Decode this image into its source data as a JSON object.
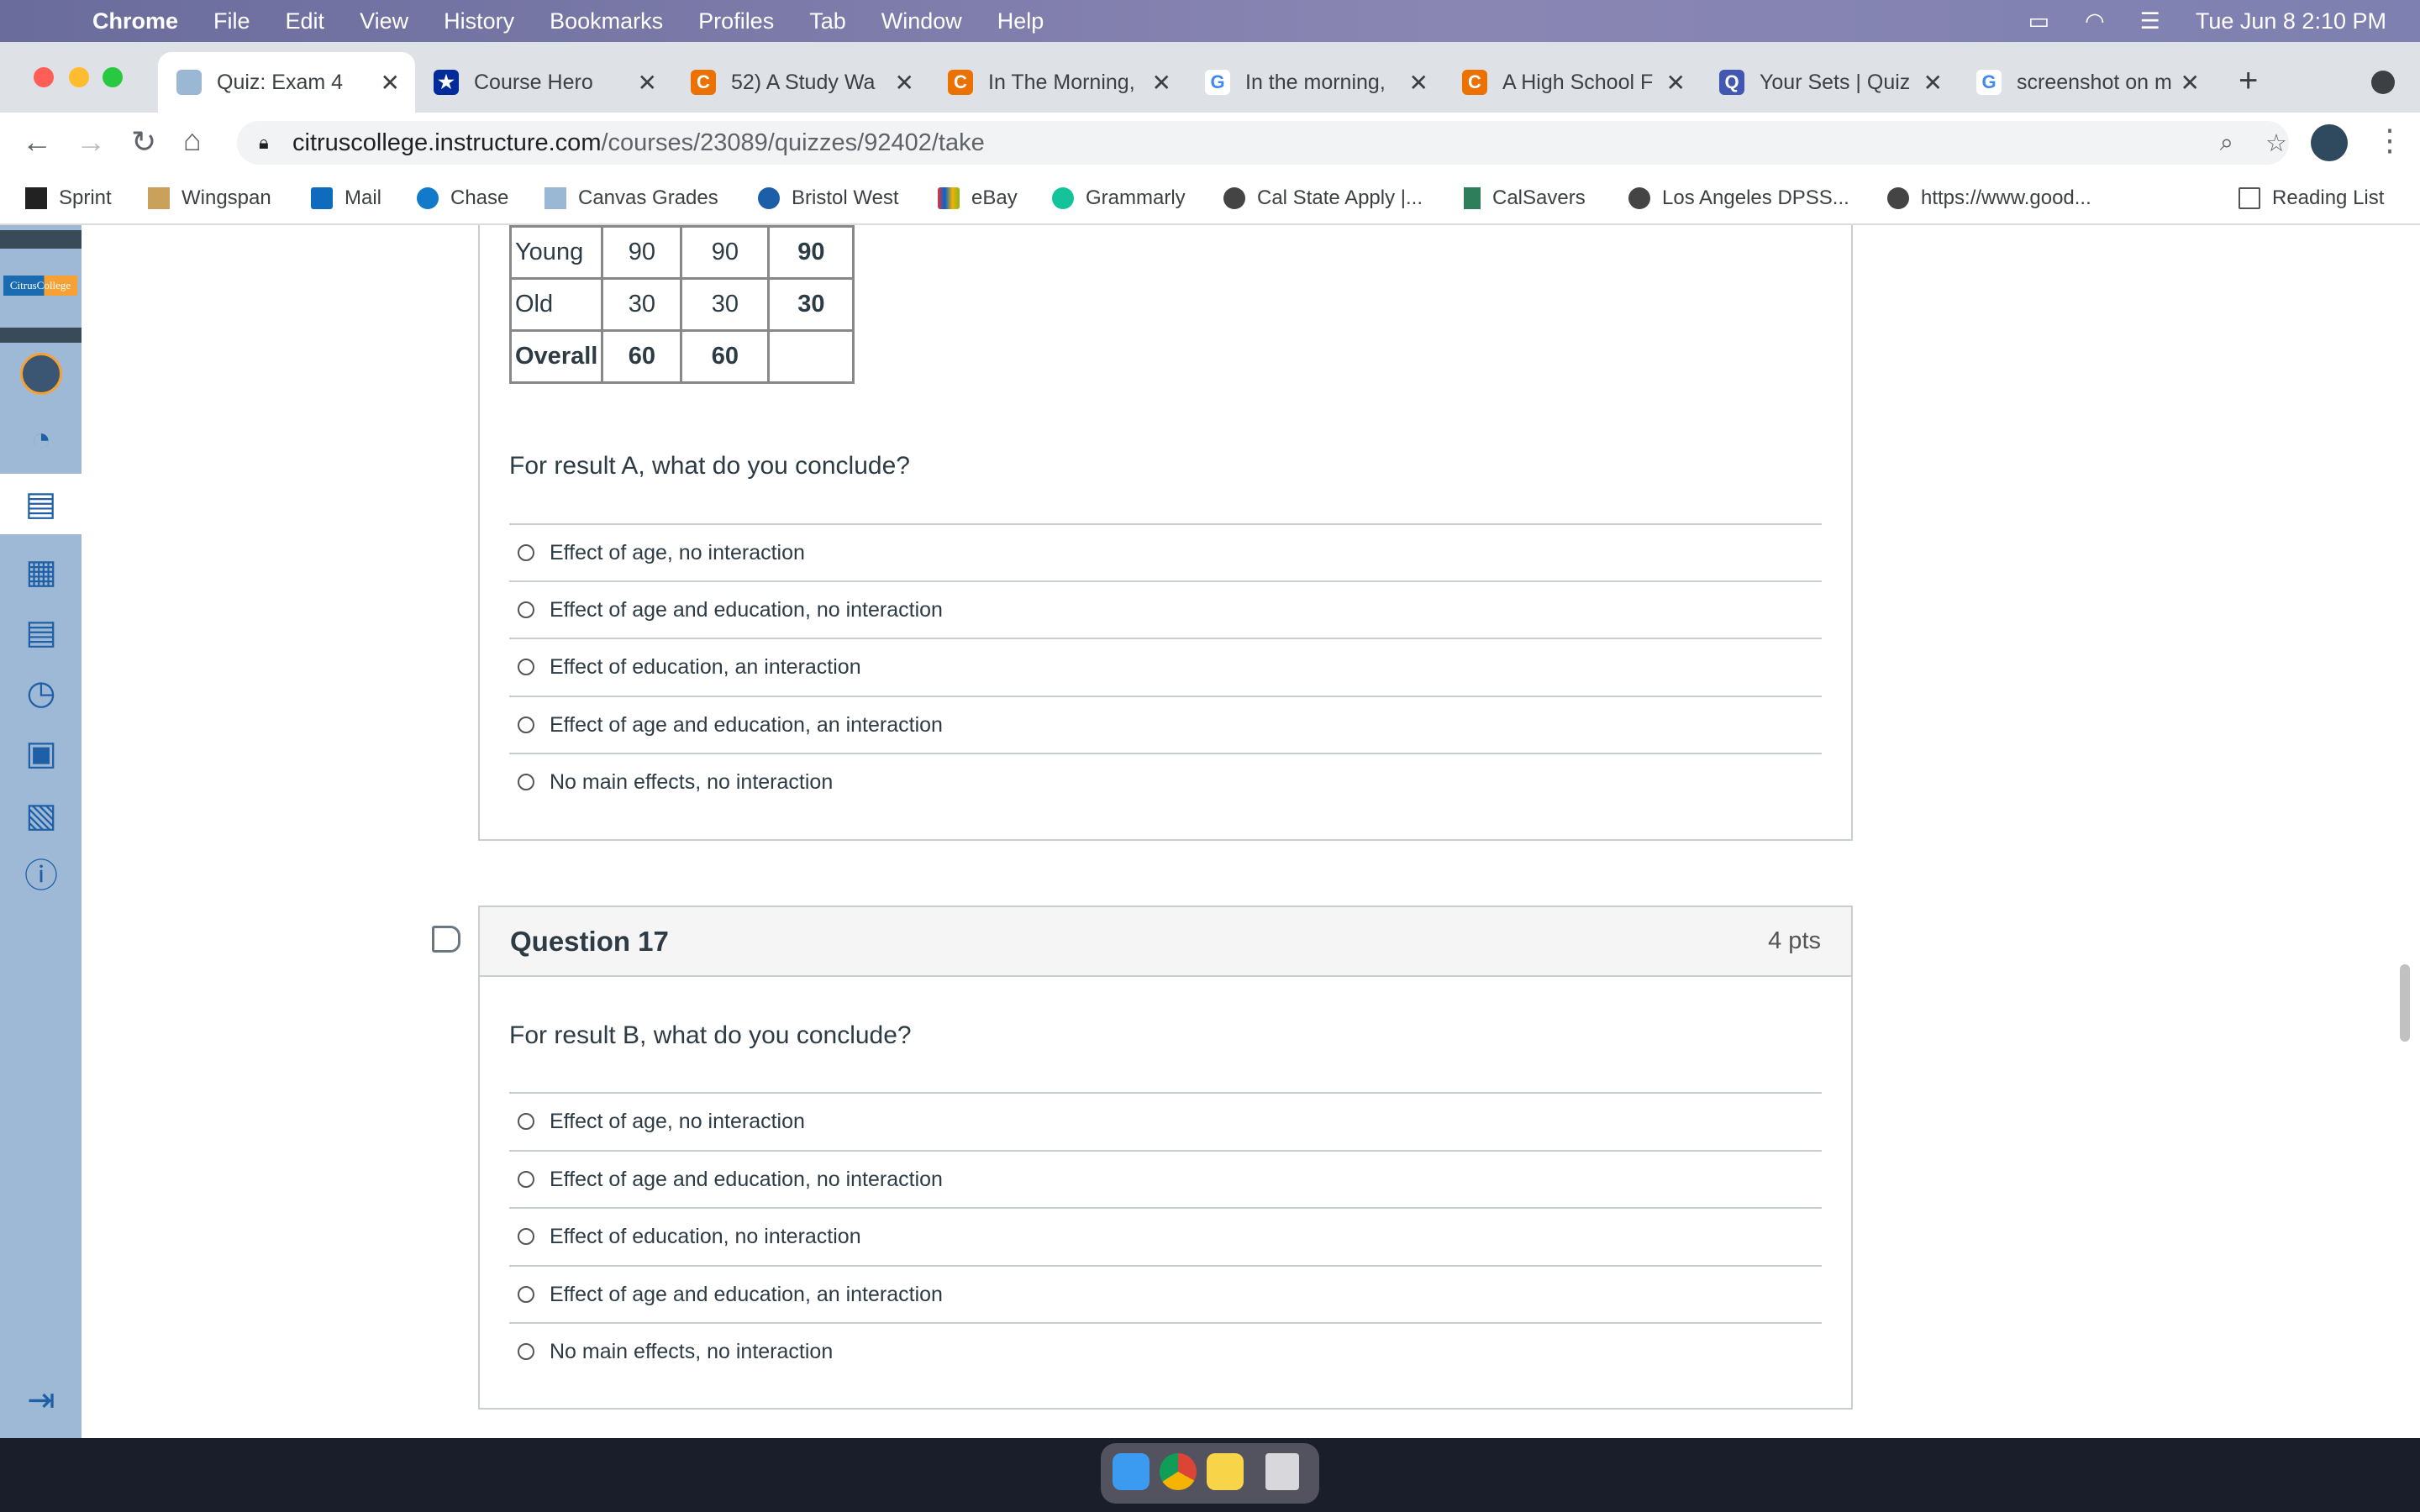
{
  "menubar": {
    "app": "Chrome",
    "items": [
      "File",
      "Edit",
      "View",
      "History",
      "Bookmarks",
      "Profiles",
      "Tab",
      "Window",
      "Help"
    ],
    "clock": "Tue Jun 8  2:10 PM"
  },
  "tabs": [
    {
      "label": "Quiz: Exam 4",
      "icon": "canvas-icon",
      "color": "#9ab7d3"
    },
    {
      "label": "Course Hero",
      "icon": "course-hero-icon",
      "color": "#002b9a"
    },
    {
      "label": "52) A Study Wa",
      "icon": "chegg-icon",
      "color": "#eb7100"
    },
    {
      "label": "In The Morning,",
      "icon": "chegg-icon",
      "color": "#eb7100"
    },
    {
      "label": "In the morning,",
      "icon": "google-icon",
      "color": "#4285f4"
    },
    {
      "label": "A High School F",
      "icon": "chegg-icon",
      "color": "#eb7100"
    },
    {
      "label": "Your Sets | Quiz",
      "icon": "quizlet-icon",
      "color": "#4257b2"
    },
    {
      "label": "screenshot on m",
      "icon": "google-icon",
      "color": "#4285f4"
    }
  ],
  "address": {
    "host": "citruscollege.instructure.com",
    "path": "/courses/23089/quizzes/92402/take"
  },
  "bookmarks": [
    "Sprint",
    "Wingspan",
    "Mail",
    "Chase",
    "Canvas Grades",
    "Bristol West",
    "eBay",
    "Grammarly",
    "Cal State Apply |...",
    "CalSavers",
    "Los Angeles DPSS...",
    "https://www.good..."
  ],
  "reading_list": "Reading List",
  "table": [
    [
      "Young",
      "90",
      "90",
      "90"
    ],
    [
      "Old",
      "30",
      "30",
      "30"
    ],
    [
      "Overall",
      "60",
      "60",
      ""
    ]
  ],
  "q16": {
    "prompt": "For result A, what do you conclude?",
    "options": [
      "Effect of age, no interaction",
      "Effect of age and education, no interaction",
      "Effect of education, an interaction",
      "Effect of age and education, an interaction",
      "No main effects, no interaction"
    ]
  },
  "q17": {
    "title": "Question 17",
    "points": "4 pts",
    "prompt": "For result B, what do you conclude?",
    "options": [
      "Effect of age, no interaction",
      "Effect of age and education, no interaction",
      "Effect of education, no interaction",
      "Effect of age and education, an interaction",
      "No main effects, no interaction"
    ]
  },
  "logo": "CitrusCollege"
}
